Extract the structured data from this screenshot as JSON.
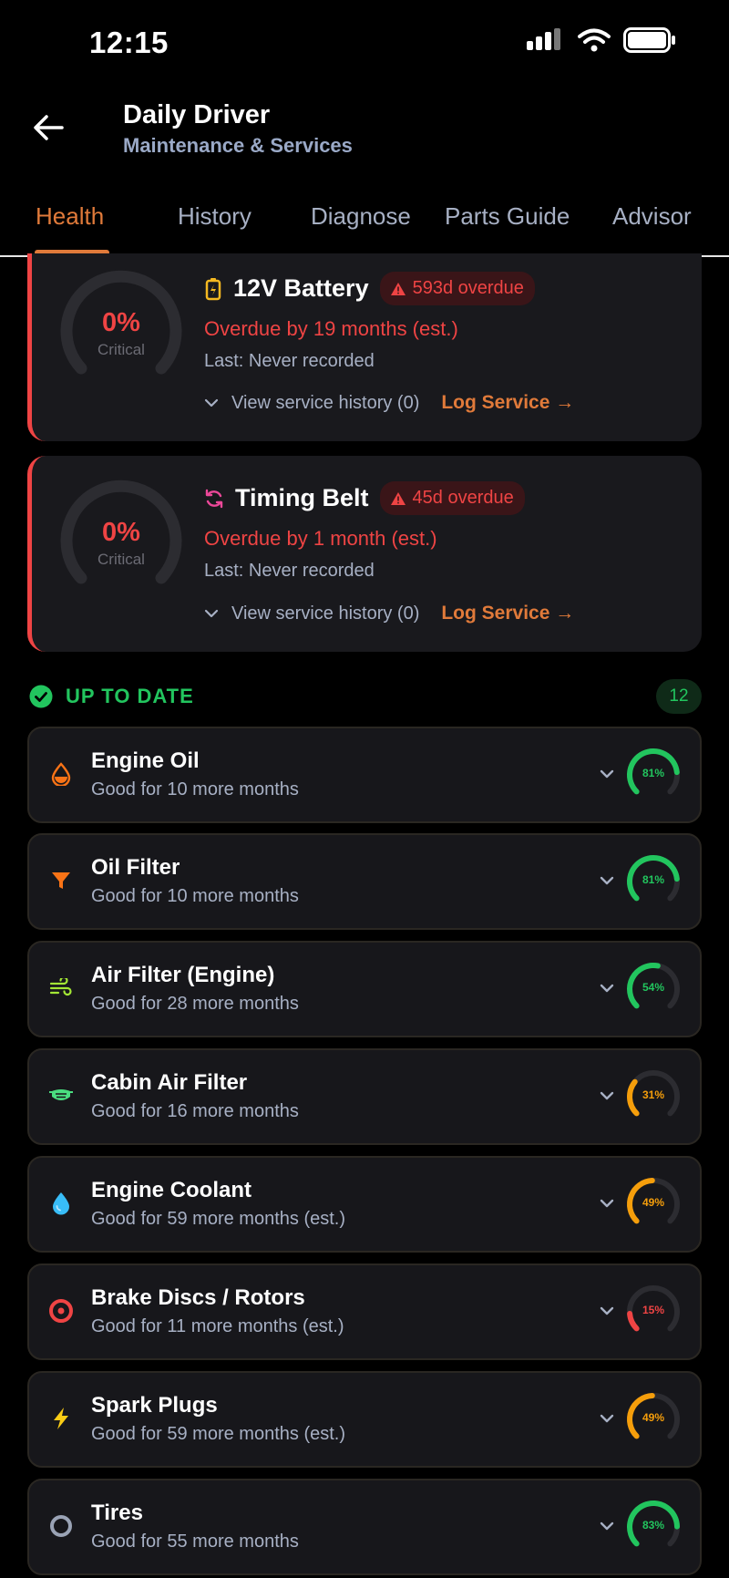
{
  "status_bar": {
    "time": "12:15"
  },
  "header": {
    "title": "Daily Driver",
    "subtitle": "Maintenance & Services"
  },
  "tabs": [
    {
      "label": "Health",
      "active": true
    },
    {
      "label": "History",
      "active": false
    },
    {
      "label": "Diagnose",
      "active": false
    },
    {
      "label": "Parts Guide",
      "active": false
    },
    {
      "label": "Advisor",
      "active": false
    }
  ],
  "overdue": [
    {
      "icon": "battery-icon",
      "title": "12V Battery",
      "badge": "593d overdue",
      "percent": "0%",
      "percent_value": 0,
      "state": "Critical",
      "line1": "Overdue by 19 months (est.)",
      "line2": "Last: Never recorded",
      "history_label": "View service history (0)",
      "log_label": "Log Service →"
    },
    {
      "icon": "refresh-icon",
      "title": "Timing Belt",
      "badge": "45d overdue",
      "percent": "0%",
      "percent_value": 0,
      "state": "Critical",
      "line1": "Overdue by 1 month (est.)",
      "line2": "Last: Never recorded",
      "history_label": "View service history (0)",
      "log_label": "Log Service →"
    }
  ],
  "up_to_date": {
    "title": "UP TO DATE",
    "count": "12",
    "items": [
      {
        "icon": "oil-drop-icon",
        "title": "Engine Oil",
        "subtitle": "Good for 10 more months",
        "percent": "81%",
        "value": 81,
        "color": "#22c55e"
      },
      {
        "icon": "funnel-icon",
        "title": "Oil Filter",
        "subtitle": "Good for 10 more months",
        "percent": "81%",
        "value": 81,
        "color": "#22c55e"
      },
      {
        "icon": "wind-icon",
        "title": "Air Filter (Engine)",
        "subtitle": "Good for 28 more months",
        "percent": "54%",
        "value": 54,
        "color": "#22c55e"
      },
      {
        "icon": "mask-icon",
        "title": "Cabin Air Filter",
        "subtitle": "Good for 16 more months",
        "percent": "31%",
        "value": 31,
        "color": "#f59e0b"
      },
      {
        "icon": "water-drop-icon",
        "title": "Engine Coolant",
        "subtitle": "Good for 59 more months (est.)",
        "percent": "49%",
        "value": 49,
        "color": "#f59e0b"
      },
      {
        "icon": "disc-icon",
        "title": "Brake Discs / Rotors",
        "subtitle": "Good for 11 more months (est.)",
        "percent": "15%",
        "value": 15,
        "color": "#ef4444"
      },
      {
        "icon": "lightning-icon",
        "title": "Spark Plugs",
        "subtitle": "Good for 59 more months (est.)",
        "percent": "49%",
        "value": 49,
        "color": "#f59e0b"
      },
      {
        "icon": "tire-icon",
        "title": "Tires",
        "subtitle": "Good for 55 more months",
        "percent": "83%",
        "value": 83,
        "color": "#22c55e"
      }
    ]
  },
  "colors": {
    "accent": "#e07a3a",
    "danger": "#ef4444",
    "ok": "#22c55e",
    "warn": "#f59e0b"
  }
}
